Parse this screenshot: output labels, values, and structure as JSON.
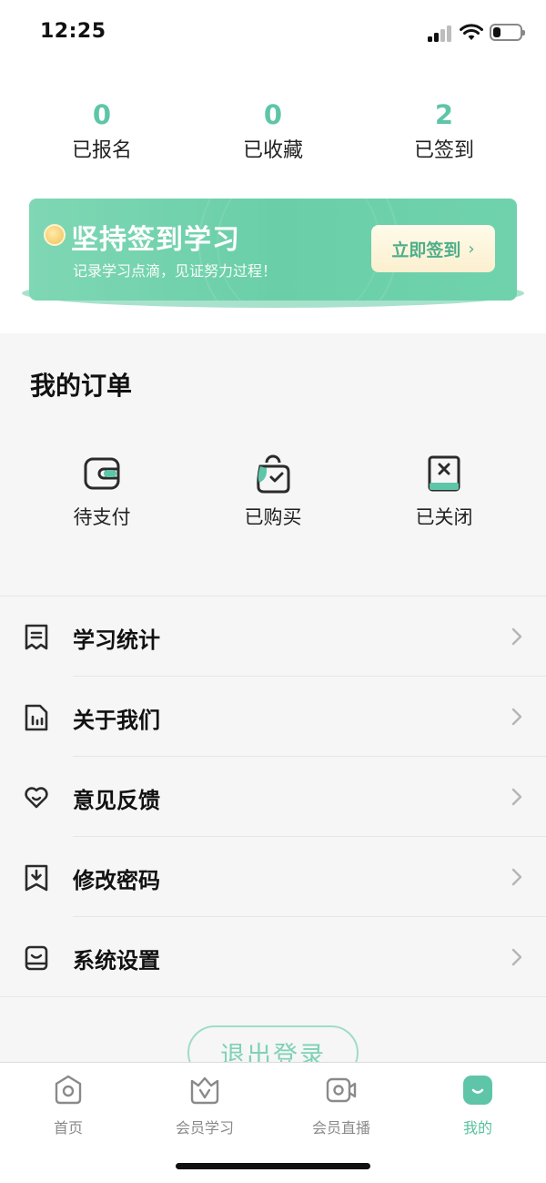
{
  "status_bar": {
    "time": "12:25",
    "signal_icon": "cellular-signal-icon",
    "wifi_icon": "wifi-icon",
    "battery_icon": "battery-icon",
    "battery_level": 0.3
  },
  "stats": [
    {
      "value": "0",
      "label": "已报名"
    },
    {
      "value": "0",
      "label": "已收藏"
    },
    {
      "value": "2",
      "label": "已签到"
    }
  ],
  "banner": {
    "icon": "coin-icon",
    "title": "坚持签到学习",
    "subtitle": "记录学习点滴，见证努力过程！",
    "button_label": "立即签到",
    "button_chevron": "›"
  },
  "orders": {
    "title": "我的订单",
    "items": [
      {
        "label": "待支付",
        "icon": "wallet-icon"
      },
      {
        "label": "已购买",
        "icon": "shopping-bag-icon"
      },
      {
        "label": "已关闭",
        "icon": "closed-book-icon"
      }
    ]
  },
  "menu": [
    {
      "label": "学习统计",
      "icon": "receipt-icon"
    },
    {
      "label": "关于我们",
      "icon": "document-chart-icon"
    },
    {
      "label": "意见反馈",
      "icon": "heart-icon"
    },
    {
      "label": "修改密码",
      "icon": "download-box-icon"
    },
    {
      "label": "系统设置",
      "icon": "monitor-icon"
    }
  ],
  "logout": {
    "label": "退出登录"
  },
  "tabbar": {
    "items": [
      {
        "label": "首页",
        "icon": "home-icon",
        "active": false
      },
      {
        "label": "会员学习",
        "icon": "vip-crown-icon",
        "active": false
      },
      {
        "label": "会员直播",
        "icon": "video-camera-icon",
        "active": false
      },
      {
        "label": "我的",
        "icon": "smile-face-icon",
        "active": true
      }
    ]
  },
  "colors": {
    "accent": "#5ec5a8",
    "banner": "#6acfa9",
    "tab_active": "#57c19e",
    "icon_stroke": "#2b2b2b"
  }
}
